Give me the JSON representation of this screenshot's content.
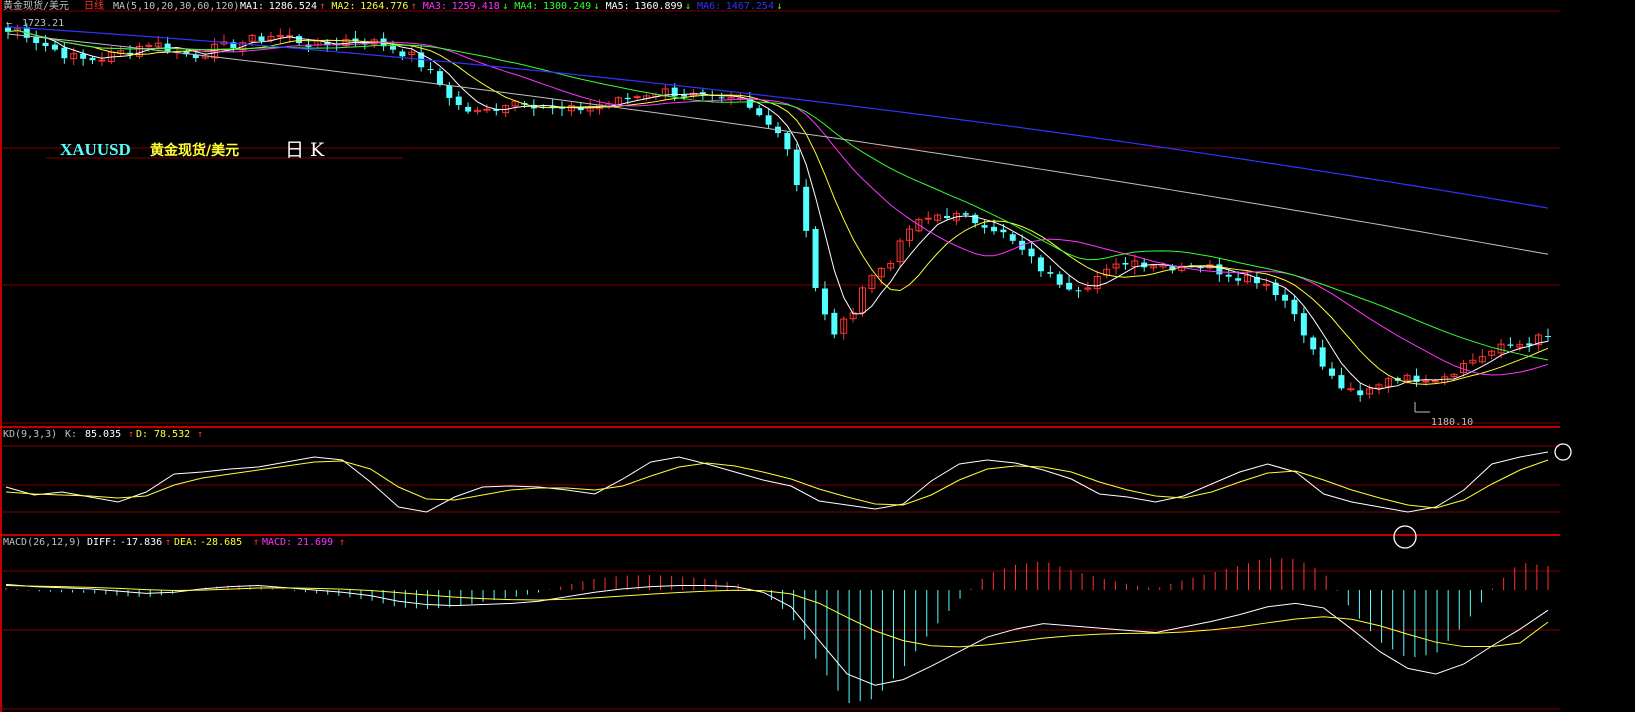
{
  "header": {
    "instrument": "黄金现货/美元",
    "period": "日线",
    "ma_params": "MA(5,10,20,30,60,120)",
    "ma": [
      {
        "label": "MA1:",
        "value": "1286.524",
        "arrow": "↑",
        "color": "#ffffff"
      },
      {
        "label": "MA2:",
        "value": "1264.776",
        "arrow": "↑",
        "color": "#ffff33"
      },
      {
        "label": "MA3:",
        "value": "1259.418",
        "arrow": "↓",
        "color": "#ff33ff"
      },
      {
        "label": "MA4:",
        "value": "1300.249",
        "arrow": "↓",
        "color": "#33ff33"
      },
      {
        "label": "MA5:",
        "value": "1360.899",
        "arrow": "↓",
        "color": "#ffffff"
      },
      {
        "label": "MA6:",
        "value": "1467.254",
        "arrow": "↓",
        "color": "#3333ff"
      }
    ]
  },
  "annotations": {
    "high_label": "1723.21",
    "low_label": "1180.10",
    "title_en": "XAUUSD",
    "title_cn": "黄金现货/美元",
    "title_period": "日 K"
  },
  "kd": {
    "params": "KD(9,3,3)",
    "k_label": "K:",
    "k_value": "85.035",
    "k_arrow": "↑",
    "d_label": "D:",
    "d_value": "78.532",
    "d_arrow": "↑"
  },
  "macd": {
    "params": "MACD(26,12,9)",
    "diff_label": "DIFF:",
    "diff_value": "-17.836",
    "diff_arrow": "↑",
    "dea_label": "DEA:",
    "dea_value": "-28.685",
    "dea_arrow": "↑",
    "macd_label": "MACD:",
    "macd_value": "21.699",
    "macd_arrow": "↑"
  },
  "colors": {
    "up": "#ff3333",
    "down": "#54ffff",
    "grid": "#800000",
    "ma5": "#ffffff",
    "ma10": "#ffff33",
    "ma20": "#ff33ff",
    "ma30": "#33ff33",
    "ma60": "#c0c0c0",
    "ma120": "#3333ff",
    "k": "#ffffff",
    "d": "#ffff33"
  },
  "chart_data": {
    "type": "candlestick",
    "price_range": [
      1180.1,
      1723.21
    ],
    "price_points": [
      1723,
      1715,
      1700,
      1690,
      1680,
      1675,
      1678,
      1685,
      1690,
      1700,
      1695,
      1685,
      1682,
      1690,
      1695,
      1700,
      1705,
      1710,
      1708,
      1700,
      1695,
      1700,
      1705,
      1702,
      1698,
      1690,
      1680,
      1660,
      1635,
      1610,
      1600,
      1605,
      1615,
      1620,
      1612,
      1606,
      1604,
      1608,
      1612,
      1616,
      1622,
      1628,
      1632,
      1629,
      1625,
      1620,
      1615,
      1620,
      1600,
      1590,
      1560,
      1480,
      1340,
      1290,
      1310,
      1360,
      1380,
      1400,
      1440,
      1450,
      1460,
      1455,
      1450,
      1445,
      1430,
      1410,
      1390,
      1370,
      1360,
      1355,
      1370,
      1380,
      1395,
      1390,
      1388,
      1385,
      1390,
      1385,
      1378,
      1372,
      1370,
      1360,
      1340,
      1310,
      1260,
      1230,
      1210,
      1200,
      1220,
      1232,
      1226,
      1230,
      1228,
      1240,
      1252,
      1262,
      1270,
      1275,
      1280,
      1287
    ],
    "kd": {
      "k": [
        55,
        47,
        50,
        45,
        40,
        50,
        68,
        70,
        73,
        75,
        80,
        85,
        82,
        60,
        35,
        30,
        45,
        55,
        56,
        55,
        52,
        48,
        63,
        80,
        85,
        78,
        70,
        62,
        56,
        41,
        37,
        33,
        38,
        61,
        78,
        82,
        79,
        72,
        63,
        48,
        45,
        40,
        46,
        58,
        70,
        78,
        70,
        48,
        40,
        35,
        30,
        35,
        52,
        78,
        85,
        90
      ],
      "d": [
        50,
        48,
        47,
        46,
        44,
        46,
        57,
        64,
        68,
        72,
        76,
        80,
        81,
        73,
        55,
        43,
        42,
        47,
        52,
        54,
        54,
        52,
        56,
        66,
        75,
        79,
        76,
        70,
        63,
        53,
        45,
        38,
        37,
        47,
        62,
        73,
        76,
        75,
        70,
        60,
        52,
        46,
        44,
        50,
        60,
        69,
        71,
        62,
        52,
        44,
        37,
        34,
        42,
        58,
        72,
        82
      ]
    },
    "macd": {
      "diff": [
        5,
        3,
        2,
        1,
        -1,
        -3,
        -2,
        1,
        3,
        4,
        2,
        0,
        -2,
        -5,
        -10,
        -13,
        -14,
        -13,
        -12,
        -10,
        -6,
        -2,
        1,
        3,
        4,
        4,
        3,
        -2,
        -15,
        -45,
        -75,
        -85,
        -80,
        -68,
        -55,
        -42,
        -35,
        -30,
        -32,
        -34,
        -36,
        -38,
        -33,
        -28,
        -22,
        -15,
        -12,
        -16,
        -35,
        -55,
        -70,
        -75,
        -66,
        -50,
        -35,
        -18
      ],
      "dea": [
        4,
        3.5,
        3,
        2.3,
        1.5,
        0.3,
        -0.4,
        -0.1,
        0.8,
        1.8,
        1.9,
        1.5,
        0.8,
        -0.4,
        -2.3,
        -4.5,
        -6.4,
        -7.7,
        -8.6,
        -8.9,
        -8.3,
        -7,
        -5.4,
        -3.7,
        -2.2,
        -1,
        -0.2,
        -0.6,
        -3.5,
        -11.8,
        -24.4,
        -36.5,
        -45.2,
        -49.8,
        -50.8,
        -49,
        -46.2,
        -43,
        -40.8,
        -39.4,
        -38.7,
        -38.6,
        -37.5,
        -35.6,
        -32.9,
        -29.3,
        -25.9,
        -23.9,
        -26.1,
        -31.9,
        -39.5,
        -46.6,
        -50.5,
        -50.4,
        -47.3,
        -28.7
      ]
    }
  }
}
